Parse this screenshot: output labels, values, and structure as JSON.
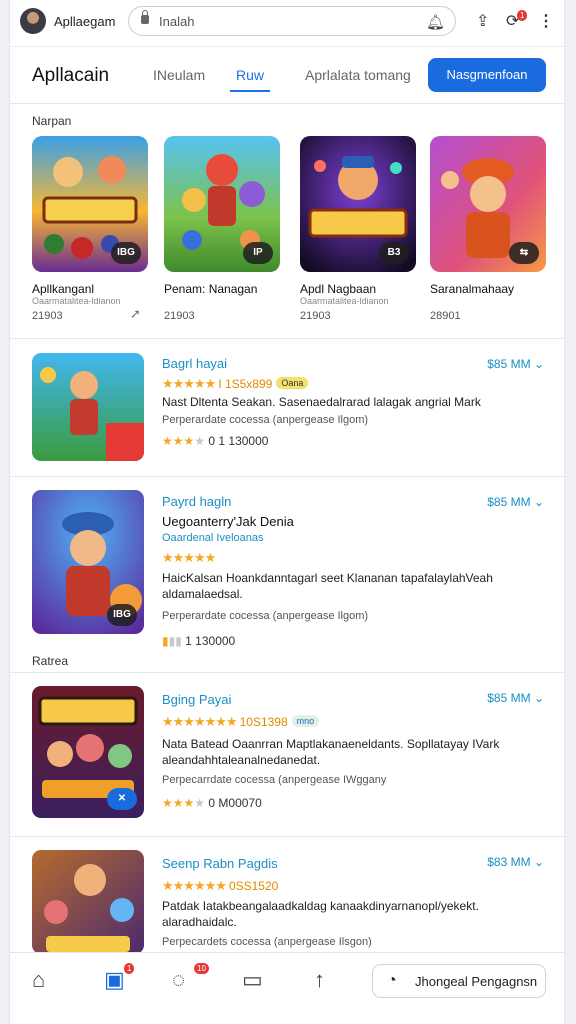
{
  "browser": {
    "app_name": "Apllaegam",
    "url_text": "Inalah",
    "notification_count": "1"
  },
  "nav": {
    "title": "Apllacain",
    "tabs": [
      "INeulam",
      "Ruw",
      "Aprlalata tomang"
    ],
    "active_tab": "Ruw",
    "cta_label": "Nasgmenfoan"
  },
  "sections": {
    "featured_label": "Narpan",
    "list_label": "Ratrea"
  },
  "featured": [
    {
      "name": "Apllkanganl",
      "subtitle": "Oaarmatalitea-ldianon",
      "number": "21903",
      "badge": "IBG",
      "icon": "share-icon"
    },
    {
      "name": "Penam: Nanagan",
      "subtitle": "",
      "number": "21903",
      "badge": "IP",
      "icon": ""
    },
    {
      "name": "Apdl Nagbaan",
      "subtitle": "Oaarmatalitea-ldianon",
      "number": "21903",
      "badge": "B3",
      "icon": ""
    },
    {
      "name": "Saranalmahaay",
      "subtitle": "",
      "number": "28901",
      "badge": "⇆",
      "icon": ""
    }
  ],
  "items": [
    {
      "name": "Bagrl hayai",
      "price": "$85 MM",
      "stars": 5,
      "metric": "I 1S5x899",
      "pill": "Oana",
      "desc": "Nast Dltenta Seakan. Sasenaedalrarad lalagak angrial Mark",
      "meta": "Perperardate cocessa (anpergease Ilgom)",
      "rating": 3,
      "count": "0 1 130000",
      "badge": ""
    },
    {
      "name": "Payrd hagln",
      "price": "$85 MM",
      "stars": 5,
      "metric": "",
      "pill": "",
      "subtitle": "Uegoanterry'Jak Denia",
      "tag": "Oaardenal Iveloanas",
      "desc": "HaicKalsan Hoankdanntagarl seet Klananan tapafalaylahVeah aldamalaedsal.",
      "meta": "Perperardate cocessa (anpergease Ilgom)",
      "rating": 0,
      "count": "1 130000",
      "badge": "IBG"
    },
    {
      "name": "Bging Payai",
      "price": "$85 MM",
      "stars": 7,
      "metric": "10S1398",
      "pill": "mno",
      "desc": "Nata Batead Oaanrran Maptlakanaeneldants. Sopllatayay IVark aleandahhtaleanalnedanedat.",
      "meta": "Perpecarrdate cocessa (anpergease IWggany",
      "rating": 3,
      "count": "0 M00070",
      "badge": "✕"
    },
    {
      "name": "Seenp Rabn Pagdis",
      "price": "$83 MM",
      "stars": 6,
      "metric": "0SS1520",
      "pill": "",
      "desc": "Patdak Iatakbeangalaadkaldag kanaakdinyarnanopl/yekekt. alaradhaidalc.",
      "meta": "Perpecardets cocessa (anpergease Ilsgon)",
      "rating": 0,
      "count": "",
      "badge": ""
    }
  ],
  "bottom": {
    "tabs": [
      "home-icon",
      "store-icon",
      "chat-icon",
      "library-icon",
      "upload-icon"
    ],
    "chat_badge": "10",
    "store_badge": "1",
    "button_label": "Jhongeal Pengagnsn"
  },
  "colors": {
    "accent": "#1a6bde",
    "link": "#1b8fc4",
    "star": "#f5a623"
  }
}
